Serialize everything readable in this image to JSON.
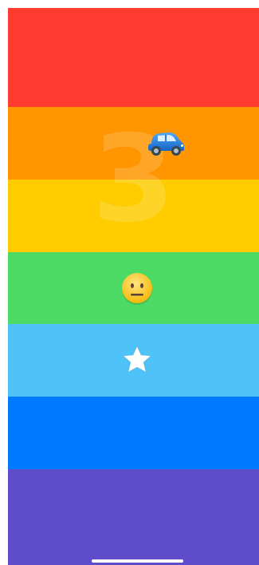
{
  "game": {
    "countdown": "3"
  },
  "lanes": [
    {
      "name": "red",
      "color": "#FF3B30"
    },
    {
      "name": "orange",
      "color": "#FF9500"
    },
    {
      "name": "yellow",
      "color": "#FFCC00"
    },
    {
      "name": "green",
      "color": "#4CD964"
    },
    {
      "name": "light-blue",
      "color": "#4FC3F7"
    },
    {
      "name": "blue",
      "color": "#007AFF"
    },
    {
      "name": "purple",
      "color": "#5E4CCB"
    }
  ],
  "pieces": {
    "car": {
      "icon": "car-icon",
      "color": "#1E88E5"
    },
    "face": {
      "icon": "neutral-face-icon",
      "color": "#FFD54F"
    },
    "star": {
      "icon": "star-icon",
      "color": "#FFFFFF"
    }
  },
  "home_indicator_color": "#FFFFFF"
}
